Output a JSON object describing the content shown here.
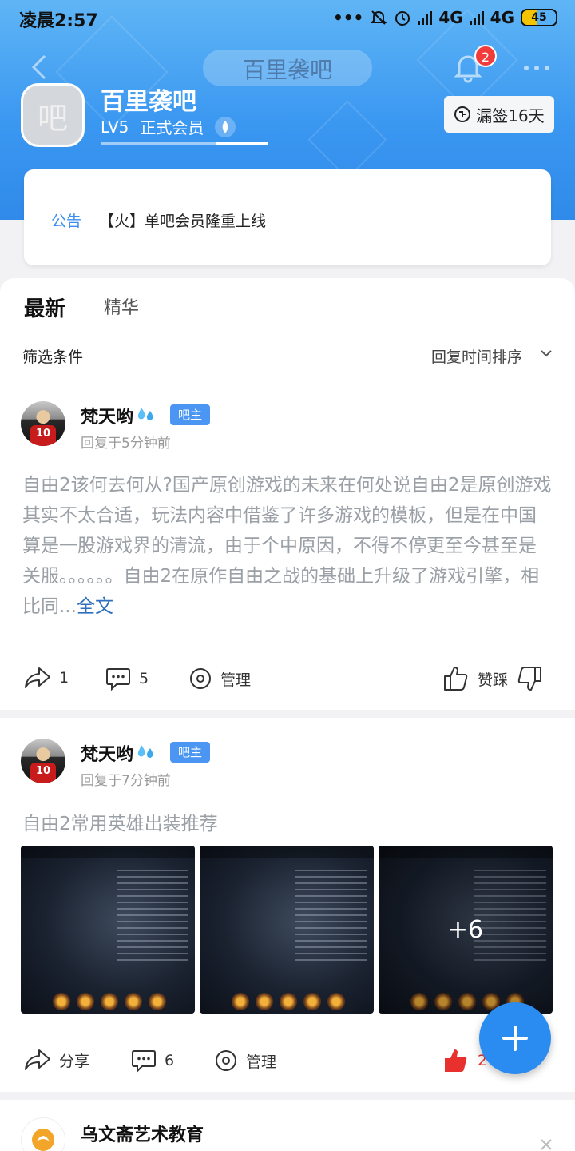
{
  "status_bar": {
    "time": "凌晨2:57",
    "net1": "4G",
    "net2": "4G",
    "battery": "45"
  },
  "nav": {
    "title": "百里袭吧",
    "notification_count": "2"
  },
  "forum": {
    "avatar_glyph": "吧",
    "name": "百里袭吧",
    "level": "LV5",
    "member_title": "正式会员",
    "sign_label": "漏签16天"
  },
  "notice": {
    "tag": "公告",
    "text": "【火】单吧会员隆重上线"
  },
  "tabs": {
    "latest": "最新",
    "best": "精华"
  },
  "filter": {
    "label": "筛选条件",
    "sort": "回复时间排序"
  },
  "posts": [
    {
      "author": "梵天哟",
      "badge": "吧主",
      "jersey": "10",
      "reply_time": "回复于5分钟前",
      "text": "自由2该何去何从?国产原创游戏的未来在何处说自由2是原创游戏其实不太合适，玩法内容中借鉴了许多游戏的模板，但是在中国算是一股游戏界的清流，由于个中原因，不得不停更至今甚至是关服。。。。。。自由2在原作自由之战的基础上升级了游戏引擎，相比同...",
      "full_link": "全文",
      "share_count": "1",
      "comment_count": "5",
      "manage_label": "管理",
      "vote_label": "赞踩"
    },
    {
      "author": "梵天哟",
      "badge": "吧主",
      "jersey": "10",
      "reply_time": "回复于7分钟前",
      "title": "自由2常用英雄出装推荐",
      "more_images": "+6",
      "share_label": "分享",
      "comment_count": "6",
      "manage_label": "管理",
      "like_count": "2"
    },
    {
      "author": "乌文斋艺术教育"
    }
  ],
  "colors": {
    "brand": "#3b98f1",
    "like": "#e8302e",
    "badge": "#4a96f2"
  }
}
